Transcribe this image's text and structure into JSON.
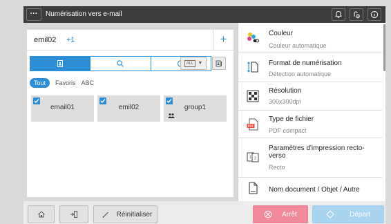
{
  "titlebar": {
    "menu_label": "···",
    "title": "Numérisation vers e-mail"
  },
  "destination": {
    "name": "emil02",
    "extra_count": "+1",
    "add_label": "+"
  },
  "address_book": {
    "all_box": "ALL"
  },
  "filters": {
    "tabs": [
      "Tout",
      "Favoris",
      "ABC"
    ]
  },
  "entries": [
    {
      "name": "email01",
      "checked": true
    },
    {
      "name": "emil02",
      "checked": true
    },
    {
      "name": "group1",
      "checked": true,
      "group": true
    }
  ],
  "settings": [
    {
      "title": "Couleur",
      "subtitle": "Couleur automatique",
      "icon": "color-icon"
    },
    {
      "title": "Format de numérisation",
      "subtitle": "Détection automatique",
      "icon": "scan-size-icon"
    },
    {
      "title": "Résolution",
      "subtitle": "300x300dpi",
      "icon": "resolution-icon"
    },
    {
      "title": "Type de fichier",
      "subtitle": "PDF compact",
      "icon": "file-type-icon",
      "badge": "PDF"
    },
    {
      "title": "Paramètres d'impression recto-verso",
      "subtitle": "Recto",
      "icon": "duplex-icon"
    },
    {
      "title": "Nom document / Objet / Autre",
      "subtitle": "",
      "icon": "document-name-icon"
    }
  ],
  "bottombar": {
    "reset_label": "Réinitialiser",
    "stop_label": "Arrêt",
    "start_label": "Départ"
  },
  "colors": {
    "accent": "#2a8fd8",
    "stop": "#f28a9c",
    "start": "#a9d4f0",
    "titlebar": "#3c3c3c"
  }
}
